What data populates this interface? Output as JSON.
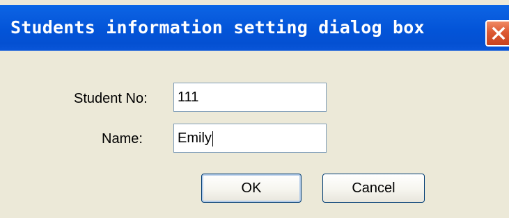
{
  "window": {
    "title": "Students information setting dialog box",
    "close_icon": "close-icon"
  },
  "form": {
    "student_no_label": "Student No:",
    "student_no_value": "111",
    "name_label": "Name:",
    "name_value": "Emily"
  },
  "buttons": {
    "ok_label": "OK",
    "cancel_label": "Cancel"
  },
  "colors": {
    "titlebar": "#0454d8",
    "dialog_bg": "#ece9d8",
    "close_button": "#d8553a"
  }
}
